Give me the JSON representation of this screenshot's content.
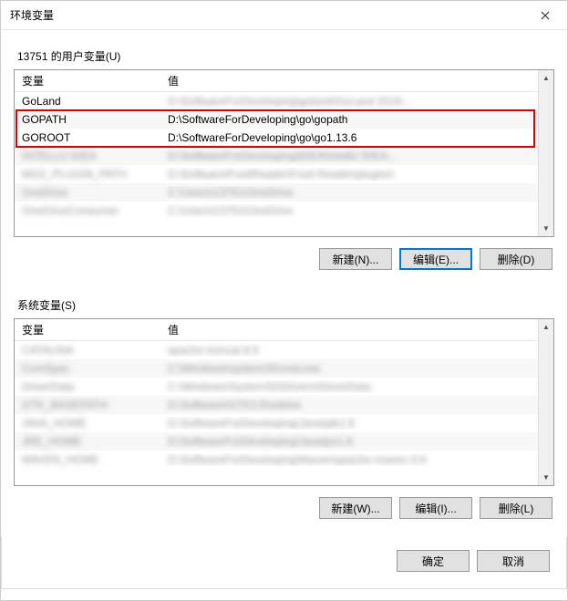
{
  "titlebar": {
    "title": "环境变量"
  },
  "userVars": {
    "label": "13751 的用户变量(U)",
    "headers": {
      "variable": "变量",
      "value": "值"
    },
    "rows": [
      {
        "variable": "GoLand",
        "value": "D:\\SoftwareForDeveloping\\goland\\GoLand 2019...",
        "blurred": "value"
      },
      {
        "variable": "GOPATH",
        "value": "D:\\SoftwareForDeveloping\\go\\gopath"
      },
      {
        "variable": "GOROOT",
        "value": "D:\\SoftwareForDeveloping\\go\\go1.13.6"
      },
      {
        "variable": "INTELLIJ IDEA",
        "value": "D:\\SoftwareForDeveloping\\IDEA\\IntelliJ IDEA...",
        "blurred": "both"
      },
      {
        "variable": "MOZ_PLUGIN_PATH",
        "value": "D:\\Software\\FoxitReader\\Foxit Reader\\plugins\\",
        "blurred": "both"
      },
      {
        "variable": "OneDrive",
        "value": "C:\\Users\\13751\\OneDrive",
        "blurred": "both"
      },
      {
        "variable": "OneDriveConsumer",
        "value": "C:\\Users\\13751\\OneDrive",
        "blurred": "both"
      }
    ],
    "buttons": {
      "new": "新建(N)...",
      "edit": "编辑(E)...",
      "delete": "删除(D)"
    }
  },
  "sysVars": {
    "label": "系统变量(S)",
    "headers": {
      "variable": "变量",
      "value": "值"
    },
    "rows": [
      {
        "variable": "CATALINA",
        "value": "apache-tomcat-8.5",
        "blurred": "both"
      },
      {
        "variable": "ComSpec",
        "value": "C:\\Windows\\system32\\cmd.exe",
        "blurred": "both"
      },
      {
        "variable": "DriverData",
        "value": "C:\\Windows\\System32\\Drivers\\DriverData",
        "blurred": "both"
      },
      {
        "variable": "GTK_BASEPATH",
        "value": "D:\\Software\\GTK2-Runtime",
        "blurred": "both"
      },
      {
        "variable": "JAVA_HOME",
        "value": "D:\\SoftwareForDeveloping\\Java\\jdk1.8",
        "blurred": "both"
      },
      {
        "variable": "JRE_HOME",
        "value": "D:\\SoftwareForDeveloping\\Java\\jre1.8",
        "blurred": "both"
      },
      {
        "variable": "MAVEN_HOME",
        "value": "D:\\SoftwareForDeveloping\\Maven\\apache-maven-3.6",
        "blurred": "both"
      }
    ],
    "buttons": {
      "new": "新建(W)...",
      "edit": "编辑(I)...",
      "delete": "删除(L)"
    }
  },
  "footer": {
    "ok": "确定",
    "cancel": "取消"
  }
}
